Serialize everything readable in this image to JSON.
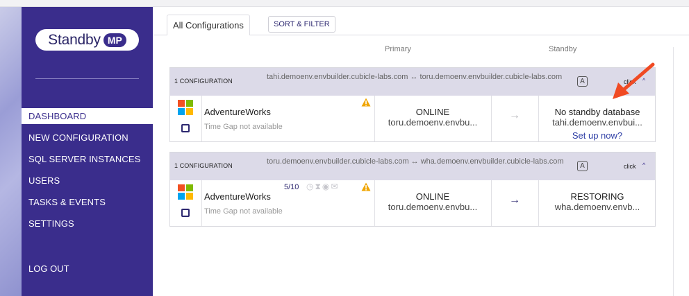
{
  "brand": {
    "name": "Standby",
    "badge": "MP"
  },
  "nav": {
    "items": [
      {
        "label": "DASHBOARD",
        "active": true
      },
      {
        "label": "NEW CONFIGURATION",
        "active": false
      },
      {
        "label": "SQL SERVER INSTANCES",
        "active": false
      },
      {
        "label": "USERS",
        "active": false
      },
      {
        "label": "TASKS & EVENTS",
        "active": false
      },
      {
        "label": "SETTINGS",
        "active": false
      }
    ],
    "logout": "LOG OUT"
  },
  "tabs": {
    "all_configurations": "All Configurations",
    "sort_filter": "SORT & FILTER"
  },
  "columns": {
    "primary": "Primary",
    "standby": "Standby"
  },
  "configurations": [
    {
      "count_label": "1 CONFIGURATION",
      "name": "tahi.demoenv.envbuilder.cubicle-labs.com ↔ toru.demoenv.envbuilder.cubicle-labs.com",
      "badge": "A",
      "click_label": "click",
      "caret": "^",
      "database": "AdventureWorks",
      "time_gap": "Time Gap not available",
      "ratio": "",
      "primary_status": "ONLINE",
      "primary_host": "toru.demoenv.envbu...",
      "arrow": "→",
      "standby_status": "No standby database",
      "standby_host": "tahi.demoenv.envbui...",
      "standby_action": "Set up now?"
    },
    {
      "count_label": "1 CONFIGURATION",
      "name": "toru.demoenv.envbuilder.cubicle-labs.com ↔ wha.demoenv.envbuilder.cubicle-labs.com",
      "badge": "A",
      "click_label": "click",
      "caret": "^",
      "database": "AdventureWorks",
      "time_gap": "Time Gap not available",
      "ratio": "5/10",
      "primary_status": "ONLINE",
      "primary_host": "toru.demoenv.envbu...",
      "arrow": "→",
      "standby_status": "RESTORING",
      "standby_host": "wha.demoenv.envb...",
      "standby_action": ""
    }
  ],
  "colors": {
    "sidebar": "#3a2d8c",
    "header_band": "#dcdae8",
    "link": "#2f3fa6",
    "warning": "#f0a500",
    "annotation_arrow": "#f04a23",
    "ms_red": "#f25022",
    "ms_green": "#7fba00",
    "ms_blue": "#00a4ef",
    "ms_yellow": "#ffb900"
  },
  "icons": {
    "db_logo": "windows-logo-icon",
    "warning": "warning-triangle-icon",
    "clock": "clock-icon",
    "hourglass": "hourglass-icon",
    "eye": "eye-icon",
    "mail": "mail-icon"
  }
}
